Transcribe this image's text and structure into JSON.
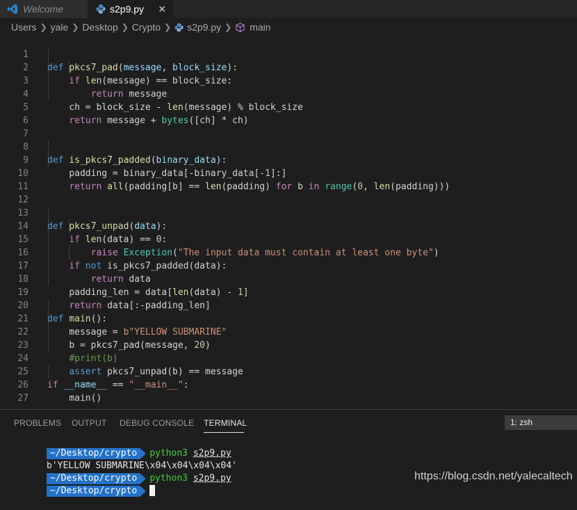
{
  "tabs": [
    {
      "label": "Welcome",
      "icon": "vscode-icon"
    },
    {
      "label": "s2p9.py",
      "icon": "python-file-icon",
      "close": "✕"
    }
  ],
  "breadcrumbs": [
    "Users",
    "yale",
    "Desktop",
    "Crypto",
    "s2p9.py",
    "main"
  ],
  "line_numbers": [
    "1",
    "2",
    "3",
    "4",
    "5",
    "6",
    "7",
    "8",
    "9",
    "10",
    "11",
    "12",
    "13",
    "14",
    "15",
    "16",
    "17",
    "18",
    "19",
    "20",
    "21",
    "22",
    "23",
    "24",
    "25",
    "26",
    "27"
  ],
  "code": {
    "l1": [
      "def",
      "pkcs7_pad",
      "(",
      "message",
      ", ",
      "block_size",
      "):"
    ],
    "l2": [
      "if",
      "len",
      "(message) == block_size:"
    ],
    "l3": [
      "return",
      " message"
    ],
    "l4": [
      "ch = block_size - ",
      "len",
      "(message) % block_size"
    ],
    "l5": [
      "return",
      " message + ",
      "bytes",
      "([ch] * ch)"
    ],
    "l8": [
      "def",
      "is_pkcs7_padded",
      "(",
      "binary_data",
      "):"
    ],
    "l9": [
      "padding = binary_data[-binary_data[",
      "-1",
      "]:]"
    ],
    "l10": [
      "return",
      "all",
      "(padding[b] == ",
      "len",
      "(padding) ",
      "for",
      " b ",
      "in",
      "range",
      "(",
      "0",
      ", ",
      "len",
      "(padding)))"
    ],
    "l13": [
      "def",
      "pkcs7_unpad",
      "(",
      "data",
      "):"
    ],
    "l14": [
      "if",
      "len",
      "(data) == ",
      "0",
      ":"
    ],
    "l15": [
      "raise",
      "Exception",
      "(",
      "\"The input data must contain at least one byte\"",
      ")"
    ],
    "l16": [
      "if",
      "not",
      " is_pkcs7_padded(data):"
    ],
    "l17": [
      "return",
      " data"
    ],
    "l18": [
      "padding_len = data[",
      "len",
      "(data) - ",
      "1",
      "]"
    ],
    "l19": [
      "return",
      " data[:-padding_len]"
    ],
    "l20": [
      "def",
      "main",
      "():"
    ],
    "l21": [
      "message = ",
      "b\"YELLOW SUBMARINE\""
    ],
    "l22": [
      "b = pkcs7_pad(message, ",
      "20",
      ")"
    ],
    "l23": [
      "#print(b)"
    ],
    "l24": [
      "assert",
      " pkcs7_unpad(b) == message"
    ],
    "l25": [
      "if",
      "__name__",
      " == ",
      "\"__main__\"",
      ":"
    ],
    "l26": [
      "main()"
    ]
  },
  "panel": {
    "tabs": [
      "PROBLEMS",
      "OUTPUT",
      "DEBUG CONSOLE",
      "TERMINAL"
    ],
    "active_tab": "TERMINAL",
    "terminal_select": "1: zsh"
  },
  "terminal": {
    "prompt": "~/Desktop/crypto",
    "cmd": "python3",
    "arg": "s2p9.py",
    "output": "b'YELLOW SUBMARINE\\x04\\x04\\x04\\x04'"
  },
  "watermark": "https://blog.csdn.net/yalecaltech",
  "colors": {
    "keyword": "#569cd6",
    "control": "#c586c0",
    "function": "#dcdcaa",
    "string": "#ce9178",
    "prompt_bg": "#2472c8",
    "command": "#3fd03f"
  }
}
